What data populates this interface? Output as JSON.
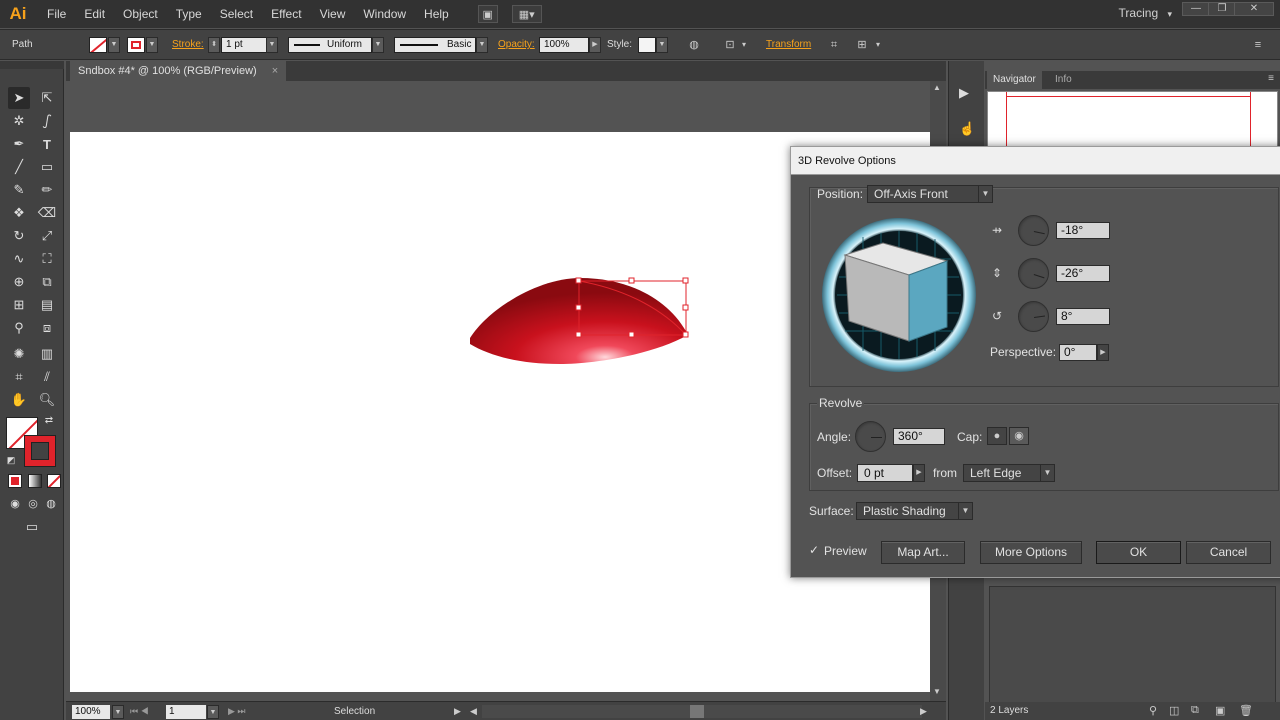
{
  "app": {
    "logo": "Ai",
    "menus": [
      "File",
      "Edit",
      "Object",
      "Type",
      "Select",
      "Effect",
      "View",
      "Window",
      "Help"
    ],
    "workspace": "Tracing",
    "workspace_arrow": "▾",
    "window_controls": {
      "minimize": "—",
      "restore": "❐",
      "close": "✕"
    }
  },
  "controlbar": {
    "selection_type": "Path",
    "stroke_label": "Stroke:",
    "stroke_weight": "1 pt",
    "uniform": "Uniform",
    "basic": "Basic",
    "opacity_label": "Opacity:",
    "opacity_value": "100%",
    "style_label": "Style:",
    "transform_label": "Transform"
  },
  "document": {
    "tab_title": "Sndbox #4* @ 100% (RGB/Preview)",
    "tab_close": "×"
  },
  "statusbar": {
    "zoom": "100%",
    "artboard": "1",
    "tool": "Selection"
  },
  "panels": {
    "navigator_tab": "Navigator",
    "info_tab": "Info",
    "layers_count": "2 Layers"
  },
  "dialog": {
    "title": "3D Revolve Options",
    "position_label": "Position:",
    "position_value": "Off-Axis Front",
    "x_rotation": "-18°",
    "y_rotation": "-26°",
    "z_rotation": "8°",
    "perspective_label": "Perspective:",
    "perspective_value": "0°",
    "revolve_legend": "Revolve",
    "angle_label": "Angle:",
    "angle_value": "360°",
    "cap_label": "Cap:",
    "offset_label": "Offset:",
    "offset_value": "0 pt",
    "from_label": "from",
    "from_value": "Left Edge",
    "surface_label": "Surface:",
    "surface_value": "Plastic Shading",
    "preview_label": "Preview",
    "preview_checked": true,
    "map_art_button": "Map Art...",
    "more_options_button": "More Options",
    "ok_button": "OK",
    "cancel_button": "Cancel"
  },
  "colors": {
    "accent": "#f7a21b",
    "shape_red": "#c3121b",
    "stroke_red": "#e0232b",
    "cube_blue": "#5ba7c0"
  }
}
